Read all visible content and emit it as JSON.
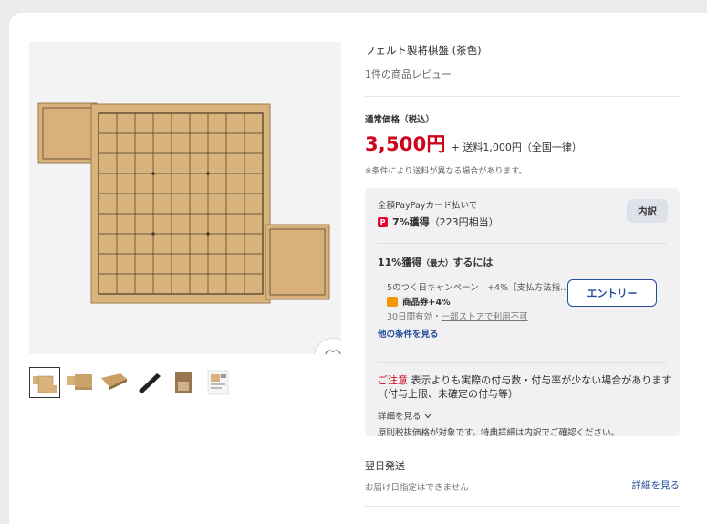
{
  "product": {
    "title": "フェルト製将棋盤 (茶色)",
    "review_link": "1件の商品レビュー"
  },
  "price": {
    "label": "通常価格（税込）",
    "amount": "3,500円",
    "shipping": "+ 送料1,000円（全国一律）",
    "note": "※条件により送料が異なる場合があります。"
  },
  "points": {
    "card_text": "全額PayPayカード払いで",
    "earn_rate": "7%獲得",
    "earn_equiv": "（223円相当）",
    "breakdown_button": "内訳",
    "max_title": "11%獲得",
    "max_note": "（最大）",
    "max_suffix": "するには",
    "campaign": "5のつく日キャンペーン　+4%【支払方法指…",
    "coupon": "商品券+4%",
    "validity": "30日間有効・",
    "validity_link": "一部ストアで利用不可",
    "entry_button": "エントリー",
    "other_conditions": "他の条件を見る",
    "caution_label": "ご注意",
    "caution_text": "表示よりも実際の付与数・付与率が少ない場合があります（付与上限、未確定の付与等）",
    "detail_link": "詳細を見る",
    "tax_note": "原則税抜価格が対象です。特典詳細は内訳でご確認ください。"
  },
  "delivery": {
    "title": "翌日発送",
    "note": "お届け日指定はできません",
    "link": "詳細を見る"
  },
  "icons": {
    "favorite": "heart-icon",
    "paypay": "paypay-icon",
    "coupon": "coupon-icon",
    "chevron": "chevron-down-icon"
  },
  "colors": {
    "price_red": "#d0021b",
    "link_blue": "#244d9a",
    "board_tan": "#d7b179"
  }
}
